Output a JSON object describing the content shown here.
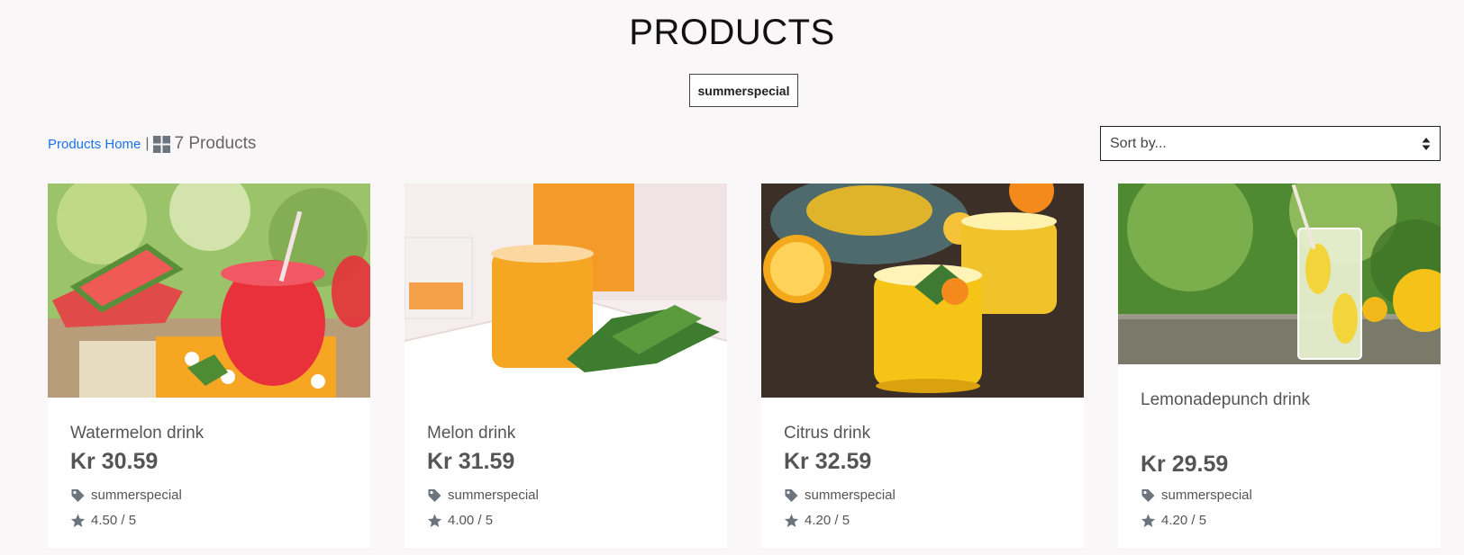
{
  "header": {
    "title": "PRODUCTS"
  },
  "filter": {
    "category": "summerspecial"
  },
  "toolbar": {
    "home_link": "Products Home",
    "separator": "|",
    "count_label": "7 Products",
    "sort_placeholder": "Sort by..."
  },
  "icons": {
    "grid": "grid-icon",
    "tag": "tag-icon",
    "star": "star-icon",
    "sort": "sort-arrows-icon"
  },
  "colors": {
    "link": "#1a73e8",
    "page_bg": "#f9f7f8",
    "card_bg": "#ffffff",
    "text": "#555555",
    "icon": "#6c757d"
  },
  "products": [
    {
      "name": "Watermelon drink",
      "price": "Kr 30.59",
      "category": "summerspecial",
      "rating": "4.50 / 5"
    },
    {
      "name": "Melon drink",
      "price": "Kr 31.59",
      "category": "summerspecial",
      "rating": "4.00 / 5"
    },
    {
      "name": "Citrus drink",
      "price": "Kr 32.59",
      "category": "summerspecial",
      "rating": "4.20 / 5"
    },
    {
      "name": "Lemonadepunch drink",
      "price": "Kr 29.59",
      "category": "summerspecial",
      "rating": "4.20 / 5"
    }
  ]
}
